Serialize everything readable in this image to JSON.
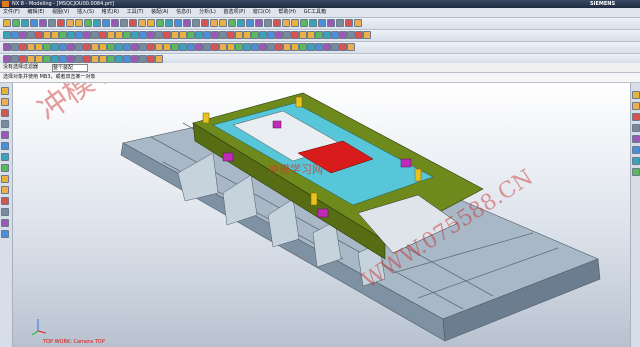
{
  "window": {
    "title": "NX 8 - Modeling - [MSQCJOU00.0084.prt]",
    "brand": "SIEMENS"
  },
  "menu": [
    "文件(F)",
    "编辑(E)",
    "视图(V)",
    "插入(S)",
    "格式(R)",
    "工具(T)",
    "装配(A)",
    "信息(I)",
    "分析(L)",
    "首选项(P)",
    "窗口(O)",
    "帮助(H)",
    "GC工具箱"
  ],
  "statusbar": {
    "filter_label": "没有选择过滤器",
    "scope_label": "整个装配",
    "prompt": "选择对象并使用 MB3，或者双击某一对象"
  },
  "viewport": {
    "view_label": "TOP WORK: Camera TOP"
  },
  "watermark": {
    "left_text": "冲模学习网",
    "site_name": "冲模学习网",
    "url": "WWW.075588.CN"
  },
  "colors": {
    "plate": "#8ea0b0",
    "plate_top": "#a8b8c6",
    "frame": "#6e8a1c",
    "accent_red": "#d81b1b",
    "magenta": "#c02ab8",
    "cyan": "#56c6d8"
  }
}
